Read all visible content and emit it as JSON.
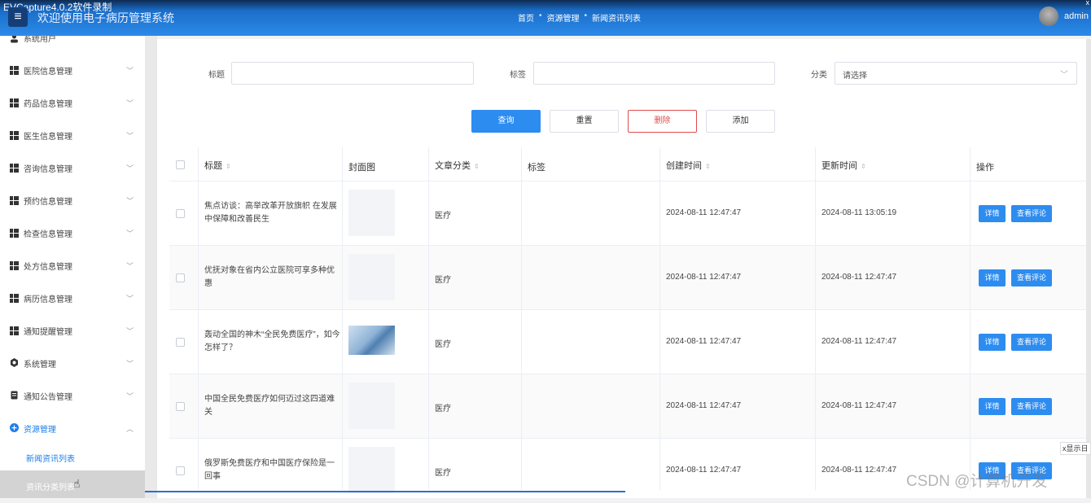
{
  "recorder_label": "EVCapture4.0.2软件录制",
  "header": {
    "title": "欢迎使用电子病历管理系统",
    "breadcrumbs": [
      "首页",
      "资源管理",
      "新闻资讯列表"
    ],
    "username": "admin",
    "close_glyph": "x"
  },
  "sidebar": {
    "items": [
      {
        "label": "系统用户",
        "icon": "user-icon",
        "expanded": false
      },
      {
        "label": "医院信息管理",
        "icon": "grid-icon",
        "expanded": false
      },
      {
        "label": "药品信息管理",
        "icon": "grid-icon",
        "expanded": false
      },
      {
        "label": "医生信息管理",
        "icon": "grid-icon",
        "expanded": false
      },
      {
        "label": "咨询信息管理",
        "icon": "grid-icon",
        "expanded": false
      },
      {
        "label": "预约信息管理",
        "icon": "grid-icon",
        "expanded": false
      },
      {
        "label": "检查信息管理",
        "icon": "grid-icon",
        "expanded": false
      },
      {
        "label": "处方信息管理",
        "icon": "grid-icon",
        "expanded": false
      },
      {
        "label": "病历信息管理",
        "icon": "grid-icon",
        "expanded": false
      },
      {
        "label": "通知提醒管理",
        "icon": "grid-icon",
        "expanded": false
      },
      {
        "label": "系统管理",
        "icon": "gear-icon",
        "expanded": false
      },
      {
        "label": "通知公告管理",
        "icon": "document-icon",
        "expanded": false
      },
      {
        "label": "资源管理",
        "icon": "plus-circle-icon",
        "expanded": true
      }
    ],
    "subitems": [
      {
        "label": "新闻资讯列表"
      },
      {
        "label": "资讯分类列表"
      }
    ]
  },
  "filters": {
    "title_label": "标题",
    "tag_label": "标签",
    "category_label": "分类",
    "category_placeholder": "请选择"
  },
  "actions": {
    "query": "查询",
    "reset": "重置",
    "delete": "删除",
    "add": "添加"
  },
  "table": {
    "headers": {
      "title": "标题",
      "cover": "封面图",
      "category": "文章分类",
      "tag": "标签",
      "created": "创建时间",
      "updated": "更新时间",
      "ops": "操作"
    },
    "rows": [
      {
        "title": "焦点访谈：高举改革开放旗帜 在发展中保障和改善民生",
        "category": "医疗",
        "tag": "",
        "created": "2024-08-11 12:47:47",
        "updated": "2024-08-11 13:05:19",
        "has_image": false
      },
      {
        "title": "优抚对象在省内公立医院可享多种优惠",
        "category": "医疗",
        "tag": "",
        "created": "2024-08-11 12:47:47",
        "updated": "2024-08-11 12:47:47",
        "has_image": false
      },
      {
        "title": "轰动全国的神木“全民免费医疗”，如今怎样了？",
        "category": "医疗",
        "tag": "",
        "created": "2024-08-11 12:47:47",
        "updated": "2024-08-11 12:47:47",
        "has_image": true
      },
      {
        "title": "中国全民免费医疗如何迈过这四道难关",
        "category": "医疗",
        "tag": "",
        "created": "2024-08-11 12:47:47",
        "updated": "2024-08-11 12:47:47",
        "has_image": false
      },
      {
        "title": "俄罗斯免费医疗和中国医疗保险是一回事",
        "category": "医疗",
        "tag": "",
        "created": "2024-08-11 12:47:47",
        "updated": "2024-08-11 12:47:47",
        "has_image": false
      }
    ],
    "row_actions": {
      "detail": "详情",
      "comments": "查看评论"
    }
  },
  "float_tip": "x显示日",
  "watermark": "CSDN @计算机开发",
  "colors": {
    "primary": "#2d8cf0",
    "danger": "#e04b4b",
    "header": "#2b8ae8"
  }
}
